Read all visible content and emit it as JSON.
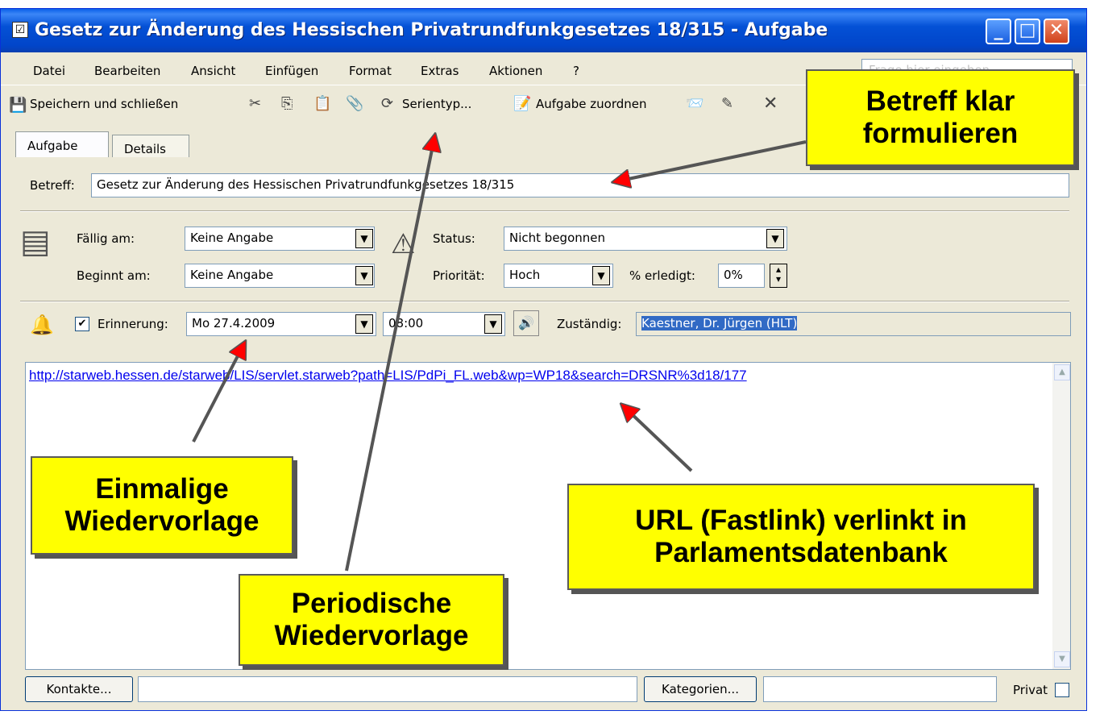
{
  "window": {
    "title": "Gesetz zur Änderung des Hessischen Privatrundfunkgesetzes 18/315 - Aufgabe"
  },
  "menu": {
    "items": [
      "Datei",
      "Bearbeiten",
      "Ansicht",
      "Einfügen",
      "Format",
      "Extras",
      "Aktionen",
      "?"
    ],
    "help_placeholder": "Frage hier eingeben"
  },
  "toolbar": {
    "save_close": "Speichern und schließen",
    "serientyp": "Serientyp...",
    "assign_task": "Aufgabe zuordnen"
  },
  "tabs": [
    "Aufgabe",
    "Details"
  ],
  "form": {
    "subject_label": "Betreff:",
    "subject_value": "Gesetz zur Änderung des Hessischen Privatrundfunkgesetzes 18/315",
    "due_label": "Fällig am:",
    "due_value": "Keine Angabe",
    "start_label": "Beginnt am:",
    "start_value": "Keine Angabe",
    "status_label": "Status:",
    "status_value": "Nicht begonnen",
    "priority_label": "Priorität:",
    "priority_value": "Hoch",
    "percent_label": "% erledigt:",
    "percent_value": "0%",
    "reminder_label": "Erinnerung:",
    "reminder_checked": "✔",
    "reminder_date": "Mo 27.4.2009",
    "reminder_time": "08:00",
    "owner_label": "Zuständig:",
    "owner_value": "Kaestner, Dr. Jürgen (HLT)"
  },
  "notes": {
    "link": "http://starweb.hessen.de/starweb/LIS/servlet.starweb?path=LIS/PdPi_FL.web&wp=WP18&search=DRSNR%3d18/177"
  },
  "footer": {
    "contacts_button": "Kontakte...",
    "categories_button": "Kategorien...",
    "private_label": "Privat"
  },
  "callouts": {
    "subject": "Betreff klar formulieren",
    "single": "Einmalige Wiedervorlage",
    "periodic": "Periodische Wiedervorlage",
    "url": "URL (Fastlink) verlinkt in Parlamentsdatenbank"
  }
}
